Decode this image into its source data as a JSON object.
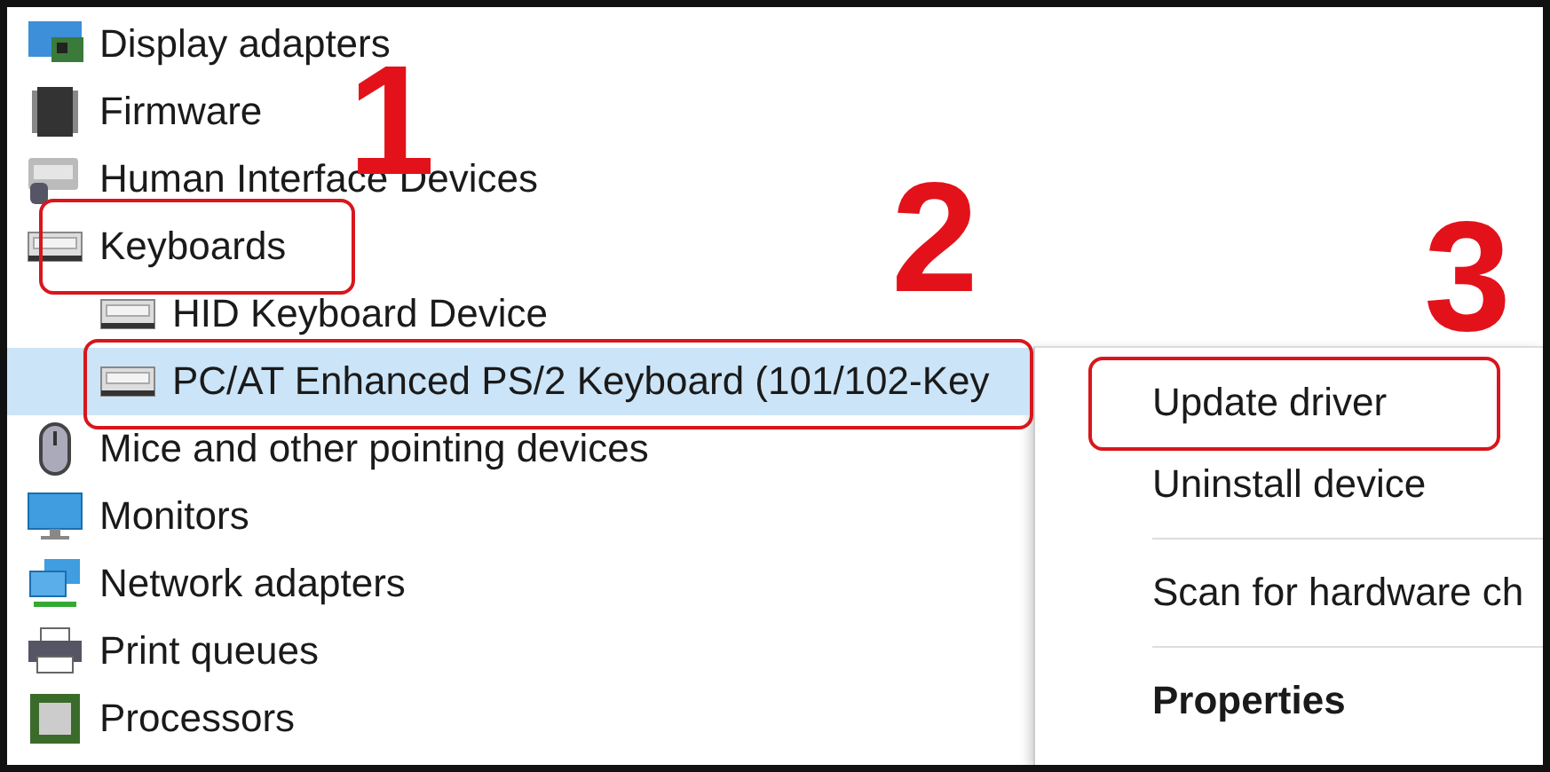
{
  "tree": [
    {
      "label": "Display adapters",
      "kind": "display",
      "selected": false,
      "outlined": false
    },
    {
      "label": "Firmware",
      "kind": "firmware",
      "selected": false,
      "outlined": false
    },
    {
      "label": "Human Interface Devices",
      "kind": "hid",
      "selected": false,
      "outlined": false
    },
    {
      "label": "Keyboards",
      "kind": "keyboard",
      "selected": false,
      "outlined": true,
      "children": [
        {
          "label": "HID Keyboard Device",
          "kind": "keyboard",
          "selected": false,
          "outlined": false
        },
        {
          "label": "PC/AT Enhanced PS/2 Keyboard (101/102-Key",
          "kind": "keyboard",
          "selected": true,
          "outlined": true
        }
      ]
    },
    {
      "label": "Mice and other pointing devices",
      "kind": "mouse",
      "selected": false,
      "outlined": false
    },
    {
      "label": "Monitors",
      "kind": "monitor",
      "selected": false,
      "outlined": false
    },
    {
      "label": "Network adapters",
      "kind": "network",
      "selected": false,
      "outlined": false
    },
    {
      "label": "Print queues",
      "kind": "printer",
      "selected": false,
      "outlined": false
    },
    {
      "label": "Processors",
      "kind": "processor",
      "selected": false,
      "outlined": false
    }
  ],
  "context_menu": [
    {
      "kind": "item",
      "label": "Update driver",
      "bold": false,
      "outlined": true
    },
    {
      "kind": "item",
      "label": "Uninstall device",
      "bold": false,
      "outlined": false
    },
    {
      "kind": "separator"
    },
    {
      "kind": "item",
      "label": "Scan for hardware ch",
      "bold": false,
      "outlined": false
    },
    {
      "kind": "separator"
    },
    {
      "kind": "item",
      "label": "Properties",
      "bold": true,
      "outlined": false
    }
  ],
  "callouts": [
    {
      "label": "1"
    },
    {
      "label": "2"
    },
    {
      "label": "3"
    }
  ]
}
